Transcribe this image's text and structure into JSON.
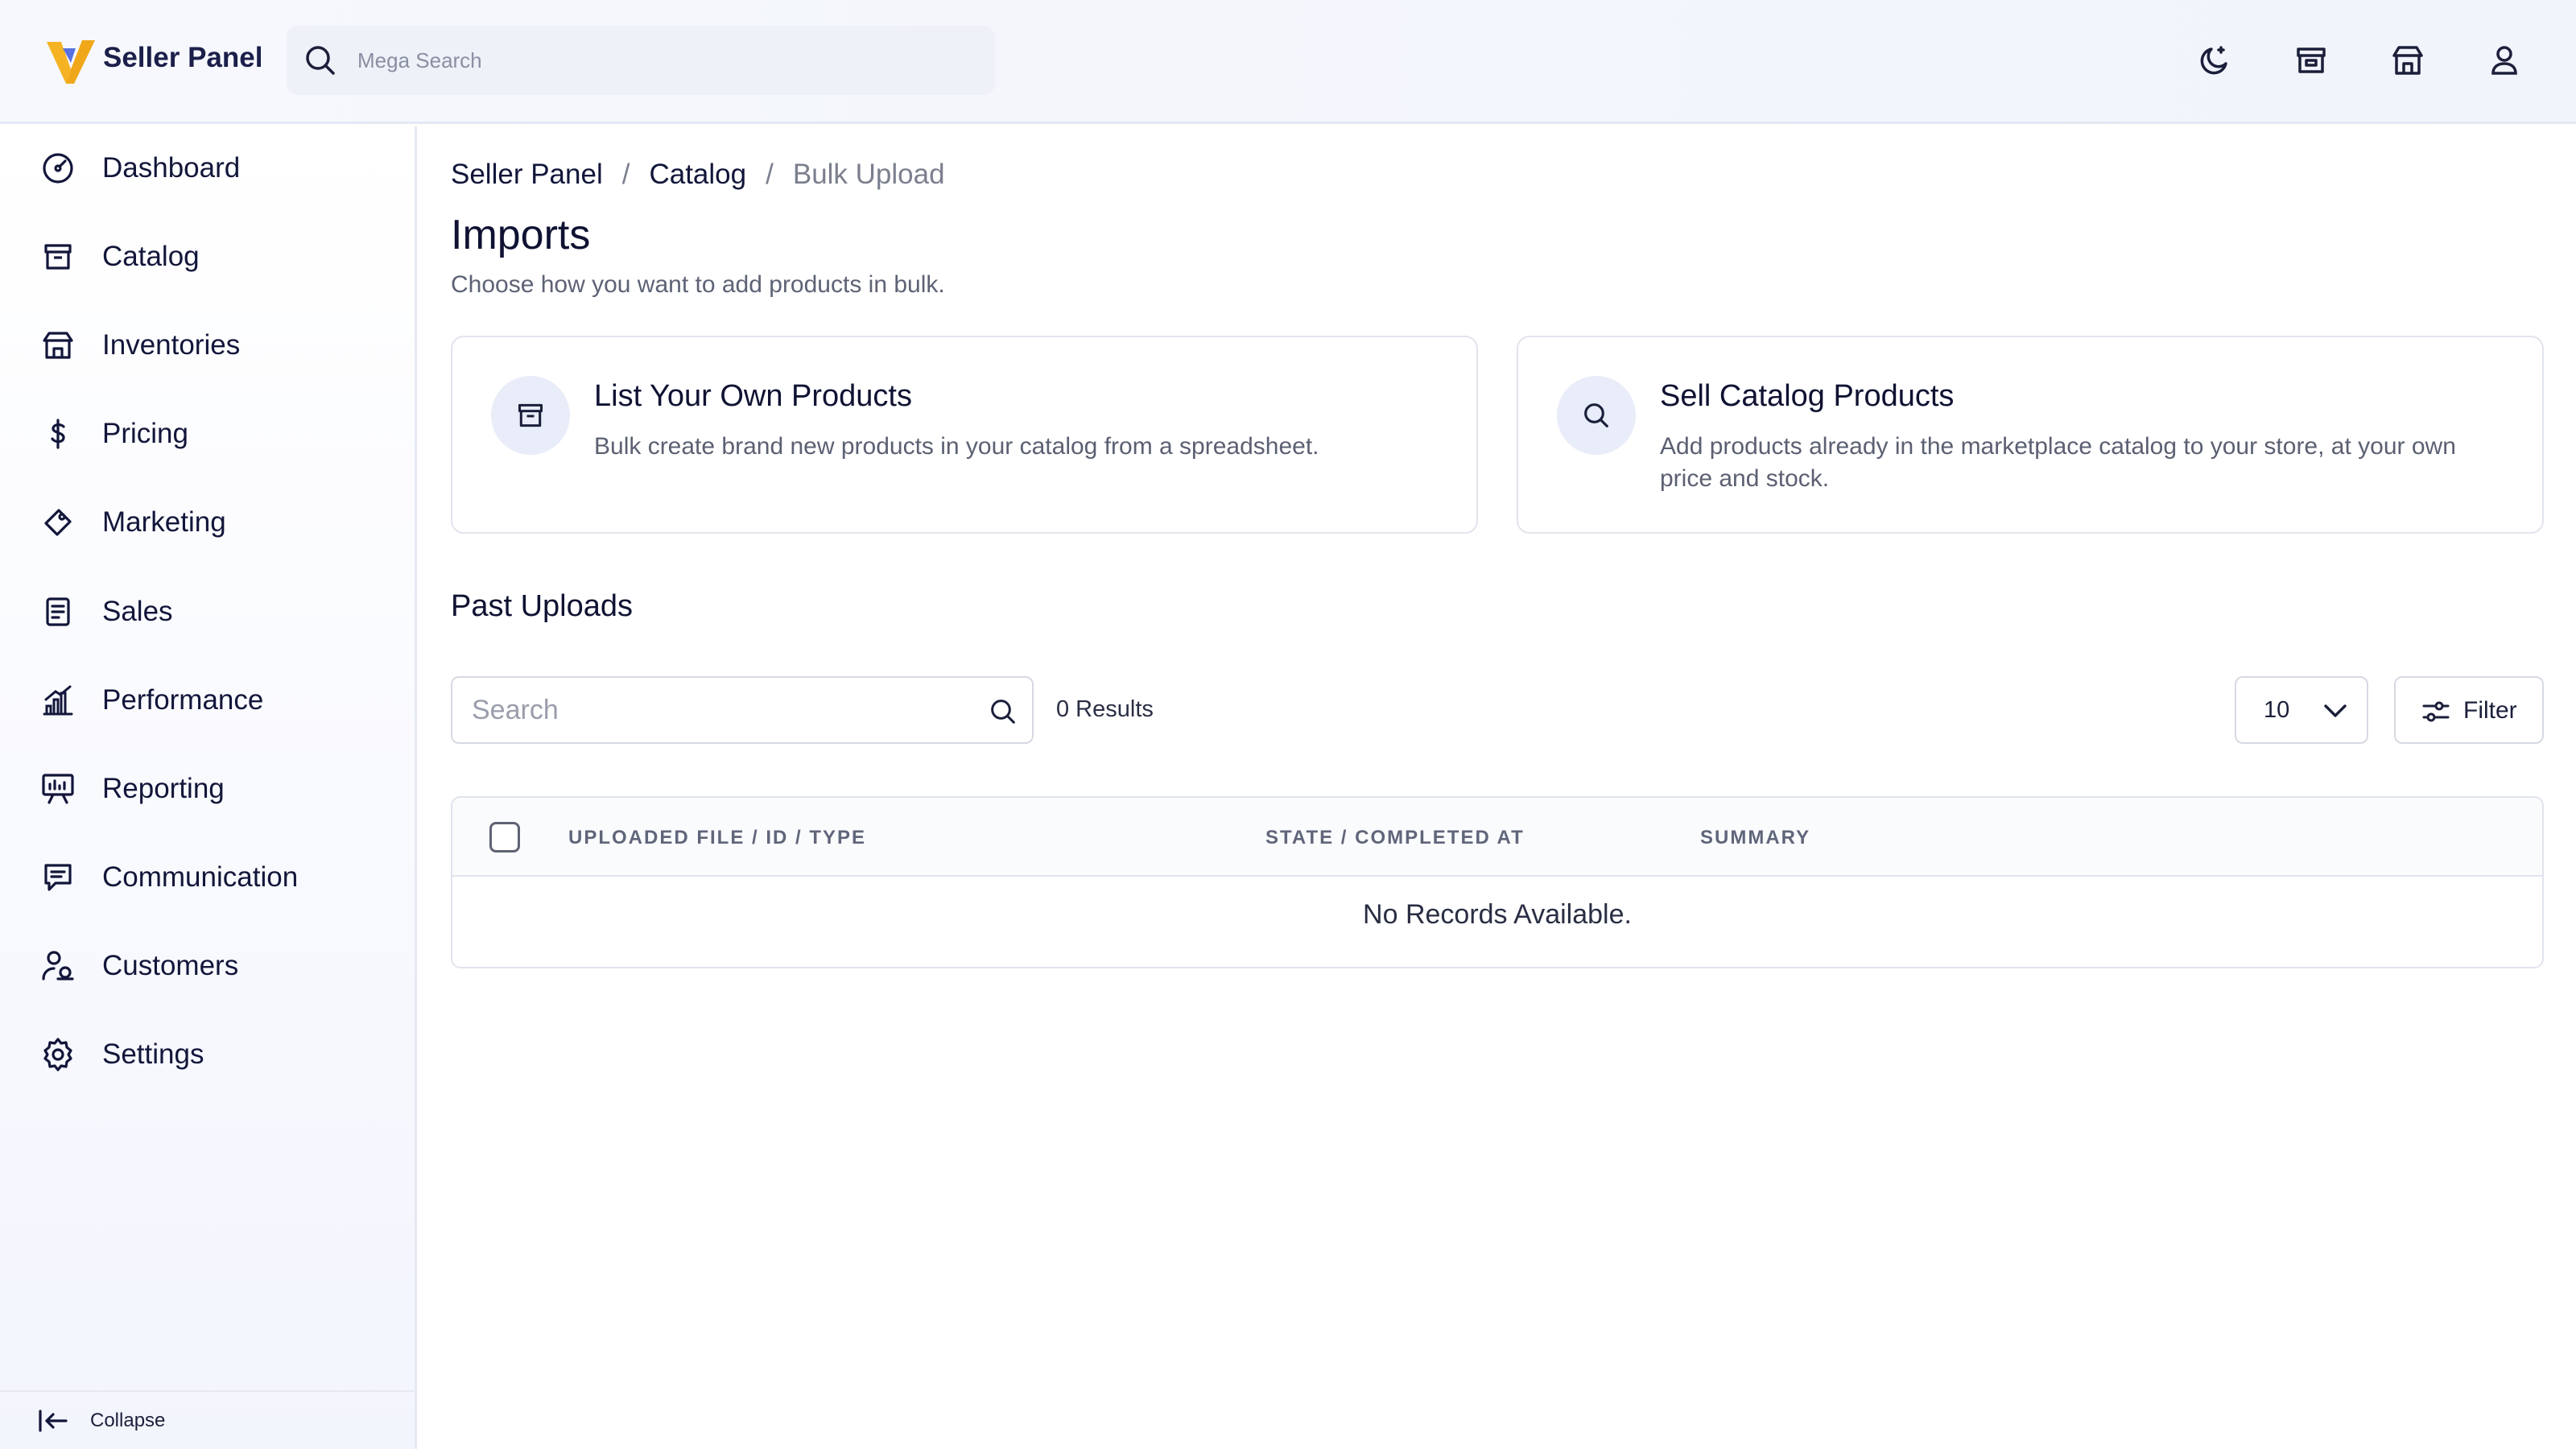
{
  "header": {
    "brand": "Seller Panel",
    "search_placeholder": "Mega Search",
    "icons": [
      "theme-toggle-icon",
      "store-icon",
      "warehouse-icon",
      "user-icon"
    ]
  },
  "sidebar": {
    "items": [
      {
        "label": "Dashboard",
        "icon": "gauge-icon"
      },
      {
        "label": "Catalog",
        "icon": "archive-box-icon"
      },
      {
        "label": "Inventories",
        "icon": "warehouse-icon"
      },
      {
        "label": "Pricing",
        "icon": "dollar-icon"
      },
      {
        "label": "Marketing",
        "icon": "megaphone-icon"
      },
      {
        "label": "Sales",
        "icon": "receipt-icon"
      },
      {
        "label": "Performance",
        "icon": "bar-chart-icon"
      },
      {
        "label": "Reporting",
        "icon": "presentation-icon"
      },
      {
        "label": "Communication",
        "icon": "message-icon"
      },
      {
        "label": "Customers",
        "icon": "users-icon"
      },
      {
        "label": "Settings",
        "icon": "gear-icon"
      }
    ],
    "collapse_label": "Collapse"
  },
  "breadcrumb": [
    "Seller Panel",
    "Catalog",
    "Bulk Upload"
  ],
  "page": {
    "title": "Imports",
    "subtitle": "Choose how you want to add products in bulk."
  },
  "cards": [
    {
      "title": "List Your Own Products",
      "description": "Bulk create brand new products in your catalog from a spreadsheet.",
      "icon": "archive-box-icon"
    },
    {
      "title": "Sell Catalog Products",
      "description": "Add products already in the marketplace catalog to your store, at your own price and stock.",
      "icon": "search-icon"
    }
  ],
  "past_uploads": {
    "title": "Past Uploads",
    "search_placeholder": "Search",
    "results_text": "0 Results",
    "page_size": "10",
    "filter_label": "Filter",
    "columns": [
      "UPLOADED FILE / ID / TYPE",
      "STATE / COMPLETED AT",
      "SUMMARY"
    ],
    "empty_text": "No Records Available."
  },
  "colors": {
    "text_primary": "#0f1232",
    "text_muted": "#5d6275",
    "border": "#e1e4ec",
    "icon_circle_bg": "#e9ecf9",
    "logo_gold": "#f5b324",
    "logo_blue": "#3b5bdb"
  }
}
